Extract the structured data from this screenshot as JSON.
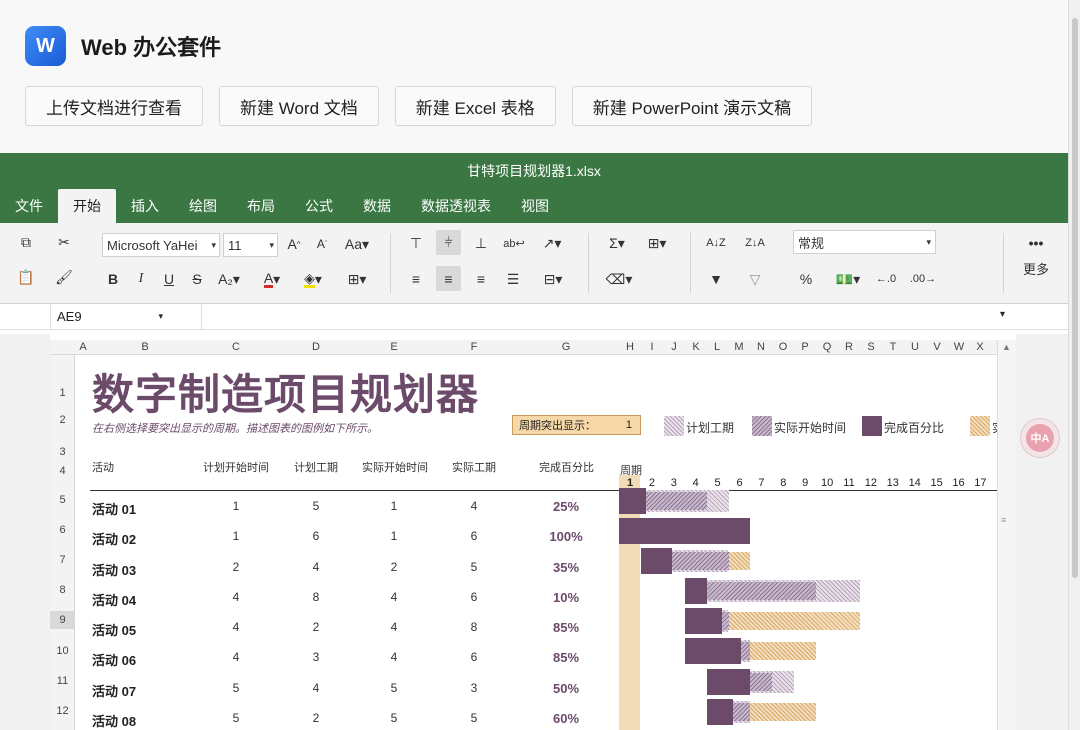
{
  "app": {
    "logo_letter": "W",
    "title": "Web 办公套件"
  },
  "top_buttons": [
    "上传文档进行查看",
    "新建 Word 文档",
    "新建 Excel 表格",
    "新建 PowerPoint 演示文稿"
  ],
  "excel": {
    "filename": "甘特项目规划器1.xlsx",
    "menu": [
      "文件",
      "开始",
      "插入",
      "绘图",
      "布局",
      "公式",
      "数据",
      "数据透视表",
      "视图"
    ],
    "active_menu": "开始",
    "font_name": "Microsoft YaHei",
    "font_size": "11",
    "number_format": "常规",
    "more_label": "更多",
    "name_box": "AE9"
  },
  "sheet": {
    "columns": [
      "A",
      "B",
      "C",
      "D",
      "E",
      "F",
      "G",
      "H",
      "I",
      "J",
      "K",
      "L",
      "M",
      "N",
      "O",
      "P",
      "Q",
      "R",
      "S",
      "T",
      "U",
      "V",
      "W",
      "X"
    ],
    "rows": [
      "1",
      "2",
      "3",
      "4",
      "5",
      "6",
      "7",
      "8",
      "9",
      "10",
      "11",
      "12"
    ],
    "title": "数字制造项目规划器",
    "subtitle": "在右侧选择要突出显示的周期。描述图表的图例如下所示。",
    "highlight_label": "周期突出显示：",
    "highlight_value": "1",
    "legend": [
      "计划工期",
      "实际开始时间",
      "完成百分比",
      "实"
    ],
    "headers": [
      "活动",
      "计划开始时间",
      "计划工期",
      "实际开始时间",
      "实际工期",
      "完成百分比",
      "周期"
    ],
    "periods": [
      "1",
      "2",
      "3",
      "4",
      "5",
      "6",
      "7",
      "8",
      "9",
      "10",
      "11",
      "12",
      "13",
      "14",
      "15",
      "16",
      "17",
      "1"
    ],
    "activities": [
      {
        "name": "活动 01",
        "plan_start": "1",
        "plan_dur": "5",
        "act_start": "1",
        "act_dur": "4",
        "pct": "25%"
      },
      {
        "name": "活动 02",
        "plan_start": "1",
        "plan_dur": "6",
        "act_start": "1",
        "act_dur": "6",
        "pct": "100%"
      },
      {
        "name": "活动 03",
        "plan_start": "2",
        "plan_dur": "4",
        "act_start": "2",
        "act_dur": "5",
        "pct": "35%"
      },
      {
        "name": "活动 04",
        "plan_start": "4",
        "plan_dur": "8",
        "act_start": "4",
        "act_dur": "6",
        "pct": "10%"
      },
      {
        "name": "活动 05",
        "plan_start": "4",
        "plan_dur": "2",
        "act_start": "4",
        "act_dur": "8",
        "pct": "85%"
      },
      {
        "name": "活动 06",
        "plan_start": "4",
        "plan_dur": "3",
        "act_start": "4",
        "act_dur": "6",
        "pct": "85%"
      },
      {
        "name": "活动 07",
        "plan_start": "5",
        "plan_dur": "4",
        "act_start": "5",
        "act_dur": "3",
        "pct": "50%"
      },
      {
        "name": "活动 08",
        "plan_start": "5",
        "plan_dur": "2",
        "act_start": "5",
        "act_dur": "5",
        "pct": "60%"
      }
    ]
  },
  "translate_label": "中A"
}
